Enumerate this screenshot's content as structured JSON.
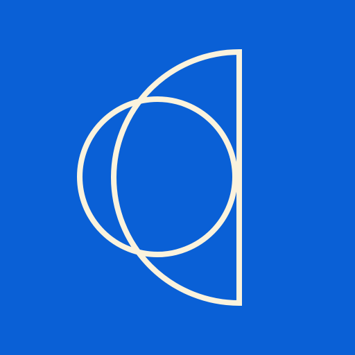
{
  "icon": {
    "name": "overlapping-circle-half-circle-logo",
    "background_color": "#0a60d6",
    "stroke_color": "#fbf3dd"
  }
}
